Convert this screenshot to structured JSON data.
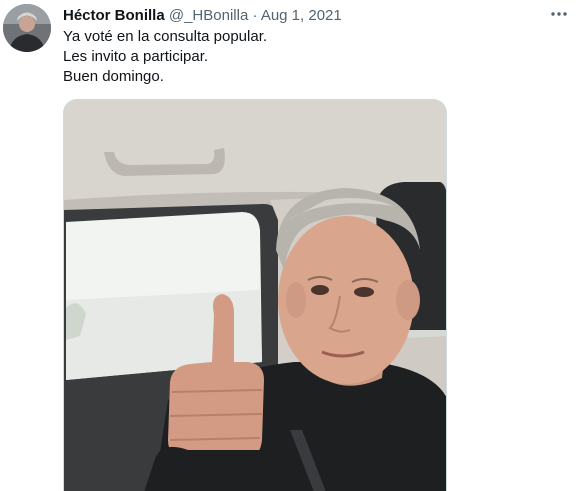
{
  "tweet": {
    "author": {
      "name": "Héctor Bonilla",
      "handle": "@_HBonilla",
      "separator": "·",
      "date": "Aug 1, 2021"
    },
    "text_lines": [
      "Ya voté en la consulta popular.",
      "Les invito a participar.",
      "Buen domingo."
    ],
    "more_icon": "more-horizontal-icon",
    "media": {
      "description_icon": "photo",
      "palette": {
        "ceiling": "#d8d4ce",
        "window": "#f2f4f2",
        "door": "#3a3b3d",
        "jacket": "#1e1f21",
        "skin": "#d9a58d",
        "hair": "#b7b3ad"
      }
    }
  }
}
